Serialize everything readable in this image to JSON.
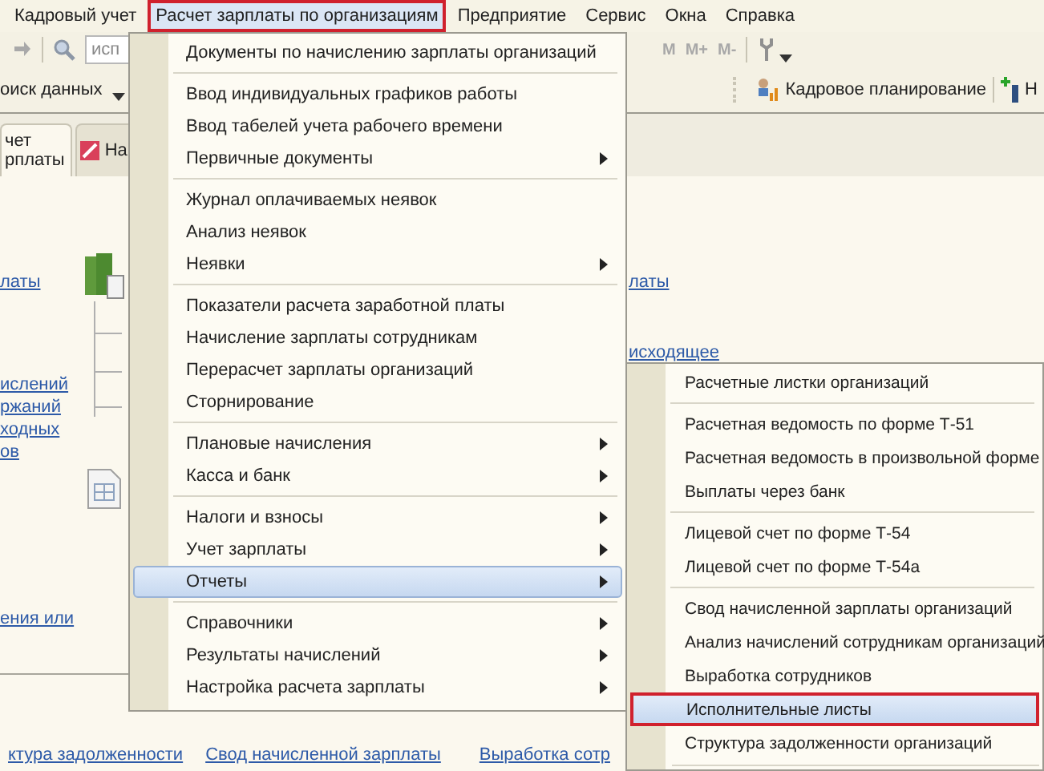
{
  "menubar": [
    {
      "label": "Кадровый учет",
      "selected": false,
      "highlighted": false
    },
    {
      "label": "Расчет зарплаты по организациям",
      "selected": true,
      "highlighted": true
    },
    {
      "label": "Предприятие",
      "selected": false,
      "highlighted": false
    },
    {
      "label": "Сервис",
      "selected": false,
      "highlighted": false
    },
    {
      "label": "Окна",
      "selected": false,
      "highlighted": false
    },
    {
      "label": "Справка",
      "selected": false,
      "highlighted": false
    }
  ],
  "toolbar": {
    "search_field": {
      "value": "исп"
    },
    "memory_buttons": [
      "M",
      "M+",
      "M-"
    ],
    "search_label": "оиск данных",
    "planning_button": "Кадровое планирование",
    "cut_button": "Н"
  },
  "tabs": [
    {
      "label_lines": [
        "чет",
        "рплаты"
      ],
      "selected": true
    },
    {
      "label_lines": [
        "На"
      ],
      "selected": false
    }
  ],
  "content": {
    "left_links_top": [
      "латы"
    ],
    "left_links_group": [
      "ислений",
      "ржаний",
      "ходных",
      "ов"
    ],
    "left_links_bottom": [
      "ения или"
    ],
    "right_links": [
      "латы",
      "исходящее"
    ],
    "bottom_links": [
      "ктура задолженности",
      "Свод начисленной зарплаты",
      "Выработка сотр"
    ]
  },
  "main_menu": {
    "items": [
      {
        "label": "Документы по начислению зарплаты организаций",
        "submenu": false,
        "selected": false,
        "divider_above": false
      },
      {
        "label": "Ввод индивидуальных графиков работы",
        "submenu": false,
        "selected": false,
        "divider_above": true
      },
      {
        "label": "Ввод табелей учета рабочего времени",
        "submenu": false,
        "selected": false,
        "divider_above": false
      },
      {
        "label": "Первичные документы",
        "submenu": true,
        "selected": false,
        "divider_above": false
      },
      {
        "label": "Журнал оплачиваемых неявок",
        "submenu": false,
        "selected": false,
        "divider_above": true
      },
      {
        "label": "Анализ неявок",
        "submenu": false,
        "selected": false,
        "divider_above": false
      },
      {
        "label": "Неявки",
        "submenu": true,
        "selected": false,
        "divider_above": false
      },
      {
        "label": "Показатели расчета заработной платы",
        "submenu": false,
        "selected": false,
        "divider_above": true
      },
      {
        "label": "Начисление зарплаты сотрудникам",
        "submenu": false,
        "selected": false,
        "divider_above": false
      },
      {
        "label": "Перерасчет зарплаты организаций",
        "submenu": false,
        "selected": false,
        "divider_above": false
      },
      {
        "label": "Сторнирование",
        "submenu": false,
        "selected": false,
        "divider_above": false
      },
      {
        "label": "Плановые начисления",
        "submenu": true,
        "selected": false,
        "divider_above": true
      },
      {
        "label": "Касса и банк",
        "submenu": true,
        "selected": false,
        "divider_above": false
      },
      {
        "label": "Налоги и взносы",
        "submenu": true,
        "selected": false,
        "divider_above": true
      },
      {
        "label": "Учет зарплаты",
        "submenu": true,
        "selected": false,
        "divider_above": false
      },
      {
        "label": "Отчеты",
        "submenu": true,
        "selected": true,
        "divider_above": false
      },
      {
        "label": "Справочники",
        "submenu": true,
        "selected": false,
        "divider_above": true
      },
      {
        "label": "Результаты начислений",
        "submenu": true,
        "selected": false,
        "divider_above": false
      },
      {
        "label": "Настройка расчета зарплаты",
        "submenu": true,
        "selected": false,
        "divider_above": false
      }
    ]
  },
  "reports_submenu": {
    "items": [
      {
        "label": "Расчетные листки организаций",
        "selected": false,
        "highlighted": false,
        "divider_above": false
      },
      {
        "label": "Расчетная ведомость по форме Т-51",
        "selected": false,
        "highlighted": false,
        "divider_above": true
      },
      {
        "label": "Расчетная ведомость в произвольной форме",
        "selected": false,
        "highlighted": false,
        "divider_above": false
      },
      {
        "label": "Выплаты через банк",
        "selected": false,
        "highlighted": false,
        "divider_above": false
      },
      {
        "label": "Лицевой счет по форме Т-54",
        "selected": false,
        "highlighted": false,
        "divider_above": true
      },
      {
        "label": "Лицевой счет по форме Т-54а",
        "selected": false,
        "highlighted": false,
        "divider_above": false
      },
      {
        "label": "Свод начисленной зарплаты организаций",
        "selected": false,
        "highlighted": false,
        "divider_above": true
      },
      {
        "label": "Анализ начислений сотрудникам организаций",
        "selected": false,
        "highlighted": false,
        "divider_above": false
      },
      {
        "label": "Выработка сотрудников",
        "selected": false,
        "highlighted": false,
        "divider_above": false
      },
      {
        "label": "Исполнительные листы",
        "selected": true,
        "highlighted": true,
        "divider_above": false
      },
      {
        "label": "Структура задолженности организаций",
        "selected": false,
        "highlighted": false,
        "divider_above": false
      }
    ]
  }
}
